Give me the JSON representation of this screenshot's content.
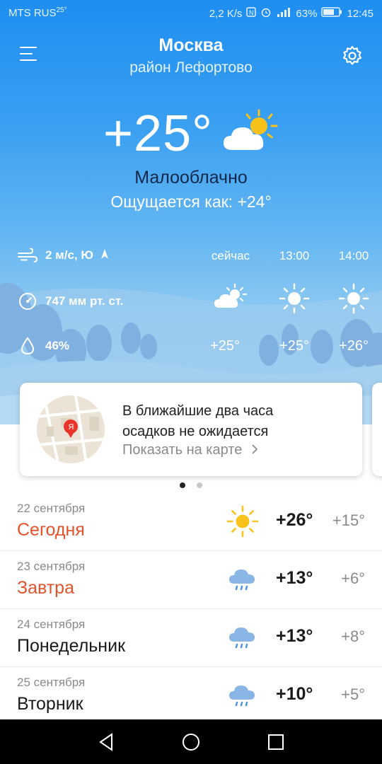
{
  "status_bar": {
    "carrier": "MTS RUS",
    "carrier_temp": "25°",
    "speed": "2,2 K/s",
    "battery": "63%",
    "time": "12:45"
  },
  "header": {
    "city": "Москва",
    "district": "район Лефортово",
    "menu_icon": "hamburger-icon",
    "settings_icon": "gear-icon"
  },
  "current": {
    "temperature": "+25°",
    "condition": "Малооблачно",
    "feels_like": "Ощущается как: +24°",
    "icon": "partly-cloudy-icon"
  },
  "details": {
    "wind": "2 м/с, Ю",
    "pressure": "747 мм рт. ст.",
    "humidity": "46%"
  },
  "hourly": [
    {
      "time": "сейчас",
      "temp": "+25°",
      "icon": "partly-cloudy-icon"
    },
    {
      "time": "13:00",
      "temp": "+25°",
      "icon": "sun-icon"
    },
    {
      "time": "14:00",
      "temp": "+26°",
      "icon": "sun-icon"
    }
  ],
  "nowcast_card": {
    "text_line1": "В ближайшие два часа",
    "text_line2": "осадков не ожидается",
    "link": "Показать на карте",
    "map_label": "Я"
  },
  "pager": {
    "count": 2,
    "active": 1
  },
  "forecast": [
    {
      "date": "22 сентября",
      "day": "Сегодня",
      "hi": "+26°",
      "lo": "+15°",
      "icon": "sun-icon",
      "highlight": true
    },
    {
      "date": "23 сентября",
      "day": "Завтра",
      "hi": "+13°",
      "lo": "+6°",
      "icon": "rain-cloud-icon",
      "highlight": true
    },
    {
      "date": "24 сентября",
      "day": "Понедельник",
      "hi": "+13°",
      "lo": "+8°",
      "icon": "rain-cloud-icon",
      "highlight": false
    },
    {
      "date": "25 сентября",
      "day": "Вторник",
      "hi": "+10°",
      "lo": "+5°",
      "icon": "rain-cloud-icon",
      "highlight": false
    }
  ],
  "colors": {
    "sky_top": "#1e8ef0",
    "accent_red": "#e2522b",
    "sun": "#f8c21a"
  }
}
